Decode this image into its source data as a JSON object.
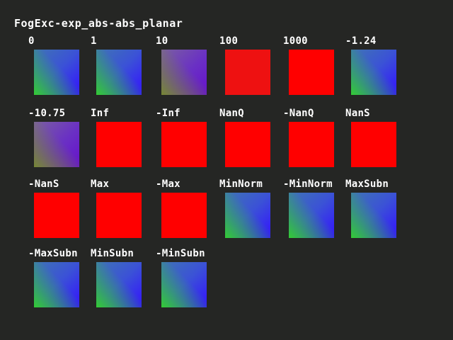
{
  "title": "FogExc-exp_abs-abs_planar",
  "colors": {
    "background": "#252624",
    "red": "#ff0000",
    "dim_red": "#ee1111",
    "green": "#33cc33",
    "blue": "#3311ff",
    "olive": "#778833",
    "purple": "#6611cc"
  },
  "cells": [
    {
      "label": "0",
      "swatch": "gradient"
    },
    {
      "label": "1",
      "swatch": "gradient"
    },
    {
      "label": "10",
      "swatch": "muted"
    },
    {
      "label": "100",
      "swatch": "dimred"
    },
    {
      "label": "1000",
      "swatch": "red"
    },
    {
      "label": "-1.24",
      "swatch": "gradient"
    },
    {
      "label": "-10.75",
      "swatch": "muted"
    },
    {
      "label": "Inf",
      "swatch": "red"
    },
    {
      "label": "-Inf",
      "swatch": "red"
    },
    {
      "label": "NanQ",
      "swatch": "red"
    },
    {
      "label": "-NanQ",
      "swatch": "red"
    },
    {
      "label": "NanS",
      "swatch": "red"
    },
    {
      "label": "-NanS",
      "swatch": "red"
    },
    {
      "label": "Max",
      "swatch": "red"
    },
    {
      "label": "-Max",
      "swatch": "red"
    },
    {
      "label": "MinNorm",
      "swatch": "gradient"
    },
    {
      "label": "-MinNorm",
      "swatch": "gradient"
    },
    {
      "label": "MaxSubn",
      "swatch": "gradient"
    },
    {
      "label": "-MaxSubn",
      "swatch": "gradient"
    },
    {
      "label": "MinSubn",
      "swatch": "gradient"
    },
    {
      "label": "-MinSubn",
      "swatch": "gradient"
    }
  ]
}
